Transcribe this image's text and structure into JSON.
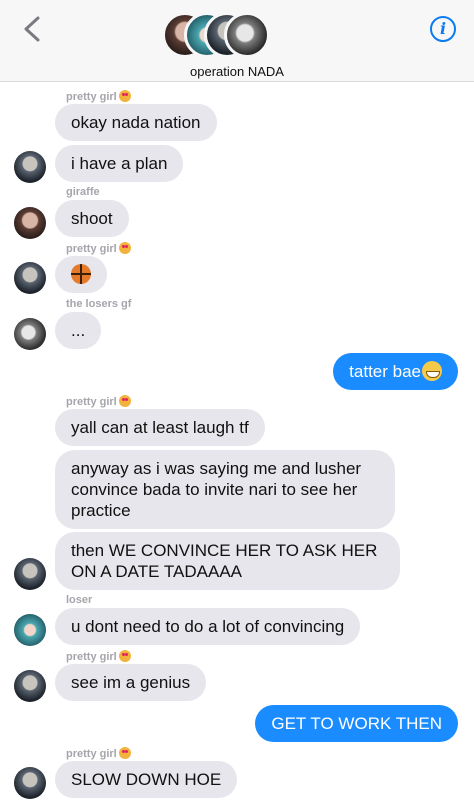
{
  "header": {
    "group_name": "operation NADA",
    "info_label": "i"
  },
  "messages": {
    "s1": "pretty girl",
    "m1": "okay nada nation",
    "m2": "i have a plan",
    "s2": "giraffe",
    "m3": "shoot",
    "s3": "pretty girl",
    "s4": "the losers gf",
    "m5": "...",
    "m6": "tatter bae",
    "s5": "pretty girl",
    "m7": "yall can at least laugh tf",
    "m8": "anyway as i was saying me and lusher convince bada to invite nari to see her practice",
    "m9": "then WE CONVINCE HER TO ASK HER ON A DATE TADAAAA",
    "s6": "loser",
    "m10": "u dont need to do a lot of convincing",
    "s7": "pretty girl",
    "m11": "see im a genius",
    "m12": "GET TO WORK THEN",
    "s8": "pretty girl",
    "m13": "SLOW DOWN HOE"
  },
  "icons": {
    "back": "chevron-left",
    "info": "info-circle",
    "basketball": "basketball-emoji",
    "grin": "grinning-sweat-emoji",
    "heart_eyes": "heart-eyes-emoji"
  },
  "colors": {
    "incoming_bubble": "#e6e6ec",
    "outgoing_bubble": "#1a8cff",
    "accent": "#0b7bf0"
  }
}
